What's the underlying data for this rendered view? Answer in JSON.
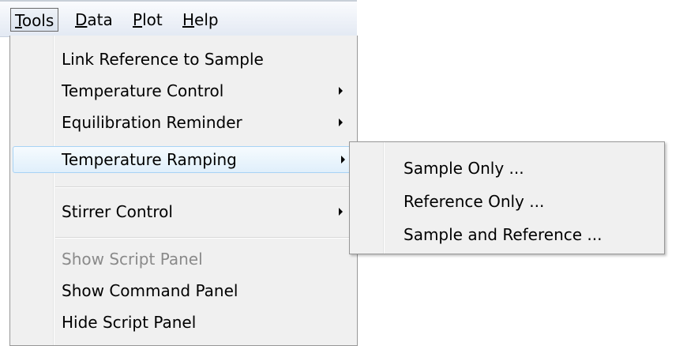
{
  "menubar": {
    "items": [
      {
        "label": "Tools",
        "mnemonic": "T",
        "rest": "ools"
      },
      {
        "label": "Data",
        "mnemonic": "D",
        "rest": "ata"
      },
      {
        "label": "Plot",
        "mnemonic": "P",
        "rest": "lot"
      },
      {
        "label": "Help",
        "mnemonic": "H",
        "rest": "elp"
      }
    ]
  },
  "tools_menu": {
    "items": [
      {
        "label": "Link Reference to Sample"
      },
      {
        "label": "Temperature Control",
        "has_submenu": true
      },
      {
        "label": "Equilibration Reminder",
        "has_submenu": true
      },
      {
        "label": "Temperature Ramping",
        "has_submenu": true,
        "highlighted": true
      },
      {
        "label": "Stirrer Control",
        "has_submenu": true
      },
      {
        "label": "Show Script Panel",
        "disabled": true
      },
      {
        "label": "Show Command Panel"
      },
      {
        "label": "Hide Script Panel"
      }
    ]
  },
  "ramping_submenu": {
    "items": [
      {
        "label": "Sample Only ..."
      },
      {
        "label": "Reference Only ..."
      },
      {
        "label": "Sample and Reference ..."
      }
    ]
  },
  "colors": {
    "highlight_border": "#a8d3f5",
    "menu_background": "#f0f0f0",
    "disabled_text": "#8a8a8a"
  },
  "icons": [
    "submenu-arrow-icon"
  ]
}
